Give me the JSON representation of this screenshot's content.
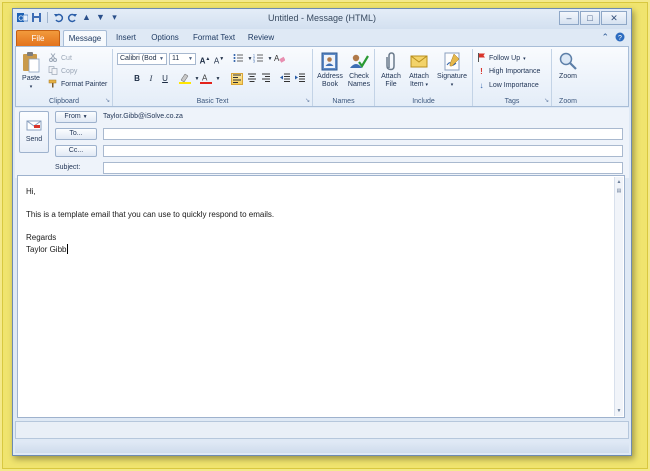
{
  "window": {
    "title": "Untitled - Message (HTML)"
  },
  "quick_access": {
    "icons": [
      "outlook-icon",
      "save-icon",
      "undo-icon",
      "redo-icon",
      "up-arrow-icon",
      "down-arrow-icon",
      "customize-icon"
    ]
  },
  "tabs": [
    "File",
    "Message",
    "Insert",
    "Options",
    "Format Text",
    "Review"
  ],
  "active_tab": "Message",
  "ribbon": {
    "clipboard": {
      "label": "Clipboard",
      "paste": "Paste",
      "cut": "Cut",
      "copy": "Copy",
      "format_painter": "Format Painter"
    },
    "basic_text": {
      "label": "Basic Text",
      "font_name": "Calibri (Bod",
      "font_size": "11",
      "bold": "B",
      "italic": "I",
      "underline": "U"
    },
    "names": {
      "label": "Names",
      "address_book_1": "Address",
      "address_book_2": "Book",
      "check_names_1": "Check",
      "check_names_2": "Names"
    },
    "include": {
      "label": "Include",
      "attach_file_1": "Attach",
      "attach_file_2": "File",
      "attach_item_1": "Attach",
      "attach_item_2": "Item",
      "signature": "Signature"
    },
    "tags": {
      "label": "Tags",
      "follow_up": "Follow Up",
      "high_importance": "High Importance",
      "low_importance": "Low Importance"
    },
    "zoom": {
      "label": "Zoom",
      "zoom": "Zoom"
    }
  },
  "header": {
    "send": "Send",
    "from_button": "From",
    "from_value": "Taylor.Gibb@iSolve.co.za",
    "to_button": "To...",
    "cc_button": "Cc...",
    "subject_label": "Subject:"
  },
  "body": {
    "lines": [
      "Hi,",
      "This is a template email that you can use to quickly respond to emails.",
      "Regards",
      "Taylor Gibb"
    ]
  },
  "colors": {
    "file_tab": "#e2701b",
    "ribbon_bg": "#e4edf8",
    "frame": "#f0e46e"
  }
}
